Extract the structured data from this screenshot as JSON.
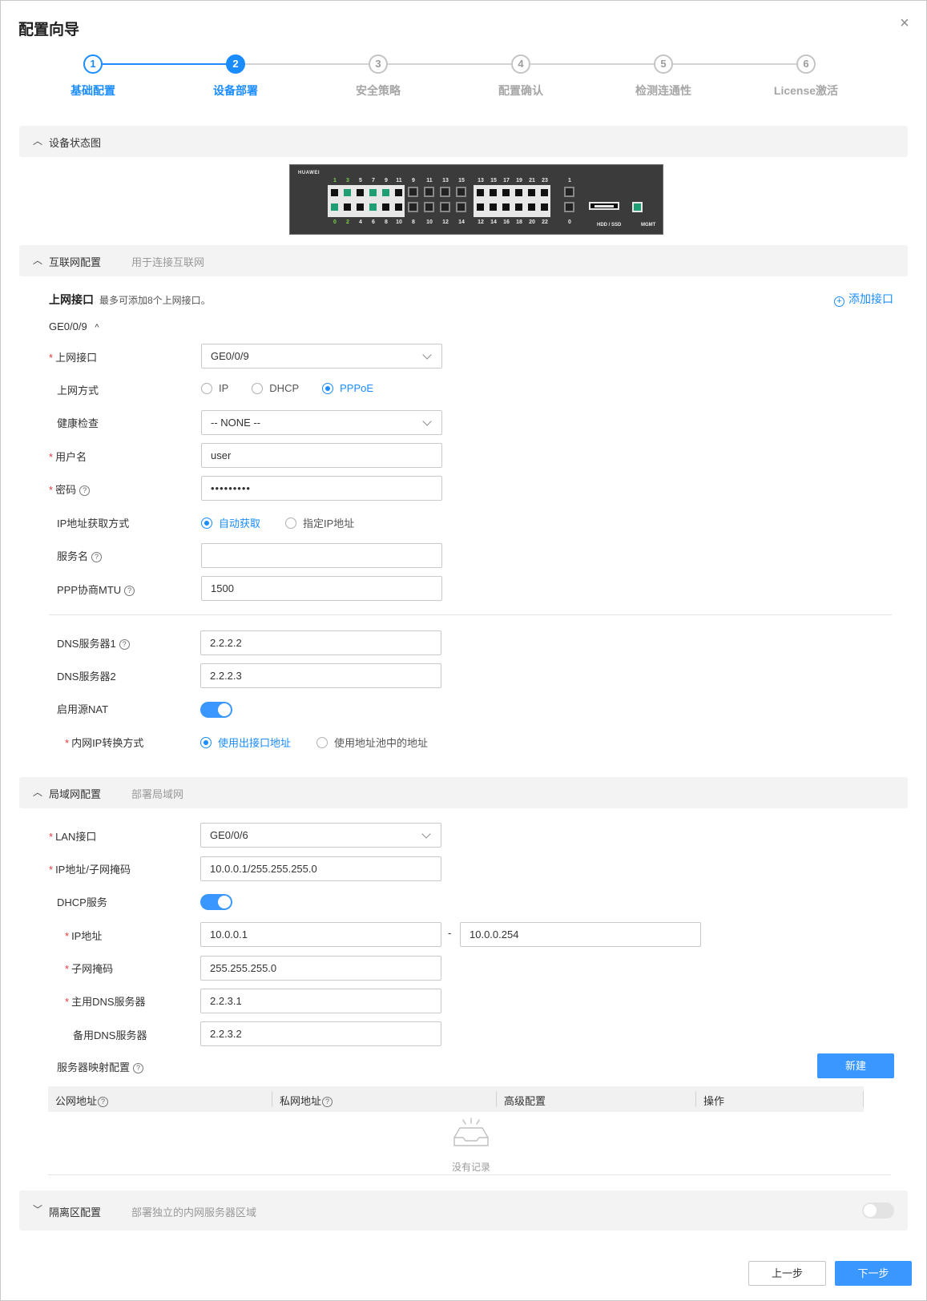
{
  "dialog": {
    "title": "配置向导",
    "close_icon": "×"
  },
  "steps": [
    {
      "num": "1",
      "label": "基础配置"
    },
    {
      "num": "2",
      "label": "设备部署"
    },
    {
      "num": "3",
      "label": "安全策略"
    },
    {
      "num": "4",
      "label": "配置确认"
    },
    {
      "num": "5",
      "label": "检测连通性"
    },
    {
      "num": "6",
      "label": "License激活"
    }
  ],
  "colors": {
    "accent": "#1a8cff",
    "port_up": "#1f9e76",
    "required": "#e8383d"
  },
  "device_status": {
    "section_title": "设备状态图",
    "brand": "HUAWEI",
    "top_nums_a": [
      "1",
      "3",
      "5",
      "7",
      "9",
      "11"
    ],
    "bottom_nums_a": [
      "0",
      "2",
      "4",
      "6",
      "8",
      "10"
    ],
    "top_nums_b": [
      "9",
      "11",
      "13",
      "15"
    ],
    "bottom_nums_b": [
      "8",
      "10",
      "12",
      "14"
    ],
    "top_nums_c": [
      "13",
      "15",
      "17",
      "19",
      "21",
      "23"
    ],
    "bottom_nums_c": [
      "12",
      "14",
      "16",
      "18",
      "20",
      "22"
    ],
    "top_num_d": "1",
    "bottom_num_d": "0",
    "hdd_label": "HDD / SSD",
    "mgmt_label": "MGMT"
  },
  "internet": {
    "section_title": "互联网配置",
    "section_sub": "用于连接互联网",
    "uplink_title": "上网接口",
    "uplink_hint": "最多可添加8个上网接口。",
    "add_link": "添加接口",
    "add_icon": "+",
    "group_name": "GE0/0/9",
    "collapse_icon": "^",
    "uplink_label": "上网接口",
    "uplink_value": "GE0/0/9",
    "mode_label": "上网方式",
    "mode_options": [
      "IP",
      "DHCP",
      "PPPoE"
    ],
    "mode_selected": "PPPoE",
    "health_label": "健康检查",
    "health_value": "-- NONE --",
    "user_label": "用户名",
    "user_value": "user",
    "pwd_label": "密码",
    "pwd_value": "•••••••••",
    "ipmode_label": "IP地址获取方式",
    "ipmode_options": [
      "自动获取",
      "指定IP地址"
    ],
    "service_label": "服务名",
    "service_value": "",
    "mtu_label": "PPP协商MTU",
    "mtu_value": "1500",
    "dns1_label": "DNS服务器1",
    "dns1_value": "2.2.2.2",
    "dns2_label": "DNS服务器2",
    "dns2_value": "2.2.2.3",
    "nat_label": "启用源NAT",
    "nat_on": true,
    "natmode_label": "内网IP转换方式",
    "natmode_options": [
      "使用出接口地址",
      "使用地址池中的地址"
    ],
    "help_icon": "?"
  },
  "lan": {
    "section_title": "局域网配置",
    "section_sub": "部署局域网",
    "lan_if_label": "LAN接口",
    "lan_if_value": "GE0/0/6",
    "ipmask_label": "IP地址/子网掩码",
    "ipmask_value": "10.0.0.1/255.255.255.0",
    "dhcp_label": "DHCP服务",
    "dhcp_on": true,
    "ip_label": "IP地址",
    "ip_start": "10.0.0.1",
    "ip_dash": "-",
    "ip_end": "10.0.0.254",
    "mask_label": "子网掩码",
    "mask_value": "255.255.255.0",
    "pdns_label": "主用DNS服务器",
    "pdns_value": "2.2.3.1",
    "sdns_label": "备用DNS服务器",
    "sdns_value": "2.2.3.2",
    "mapping_label": "服务器映射配置",
    "new_button": "新建",
    "table_headers": [
      "公网地址",
      "私网地址",
      "高级配置",
      "操作"
    ],
    "empty_text": "没有记录"
  },
  "dmz": {
    "section_title": "隔离区配置",
    "section_sub": "部署独立的内网服务器区域",
    "enabled": false
  },
  "footer": {
    "prev_label": "上一步",
    "next_label": "下一步"
  }
}
